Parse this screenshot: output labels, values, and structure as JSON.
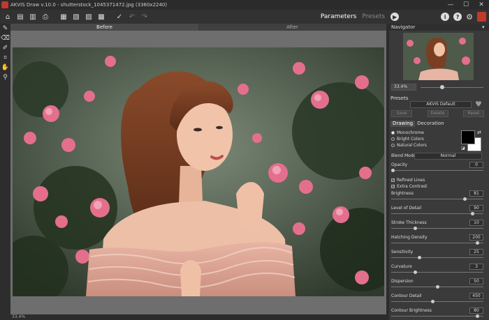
{
  "window": {
    "title": "AKVIS Draw v.10.0 - shutterstock_1045371472.jpg (3360x2240)",
    "minimize": "—",
    "maximize": "☐",
    "close": "✕"
  },
  "toolbar": {
    "tab_parameters": "Parameters",
    "tab_presets": "Presets",
    "icons": [
      "home-icon",
      "open-file-icon",
      "save-icon",
      "print-icon",
      "batch-icon",
      "image-icon",
      "copy-icon",
      "share-icon",
      "check-icon",
      "undo-icon",
      "redo-icon",
      "run-icon",
      "info-icon",
      "help-icon",
      "settings-icon",
      "akvis-logo-icon"
    ]
  },
  "canvas": {
    "tab_before": "Before",
    "tab_after": "After",
    "zoom": "33.4%"
  },
  "navigator": {
    "title": "Navigator",
    "zoom": "33.4%",
    "zoom_fraction": 0.3
  },
  "presets": {
    "label": "Presets",
    "selected": "AKVIS Default",
    "save": "Save",
    "delete": "Delete",
    "reset": "Reset"
  },
  "tabs": {
    "drawing": "Drawing",
    "decoration": "Decoration"
  },
  "modes": {
    "monochrome": "Monochrome",
    "bright": "Bright Colors",
    "natural": "Natural Colors"
  },
  "blend": {
    "label": "Blend Mode",
    "value": "Normal"
  },
  "checks": {
    "refined": "Refined Lines",
    "contrast": "Extra Contrast"
  },
  "params": [
    {
      "label": "Opacity",
      "value": "0"
    },
    {
      "label": "Brightness",
      "value": "81"
    },
    {
      "label": "Level of Detail",
      "value": "90"
    },
    {
      "label": "Stroke Thickness",
      "value": "10"
    },
    {
      "label": "Hatching Density",
      "value": "200"
    },
    {
      "label": "Sensitivity",
      "value": "25"
    },
    {
      "label": "Curvature",
      "value": "3"
    },
    {
      "label": "Dispersion",
      "value": "50"
    },
    {
      "label": "Contour Detail",
      "value": "450"
    },
    {
      "label": "Contour Brightness",
      "value": "80"
    }
  ],
  "param_fractions": [
    0.0,
    0.81,
    0.9,
    0.25,
    0.95,
    0.3,
    0.25,
    0.5,
    0.45,
    0.95
  ],
  "colors": {
    "accent": "#c0392b",
    "panel": "#3a3a3a",
    "toolbar": "#323232"
  }
}
